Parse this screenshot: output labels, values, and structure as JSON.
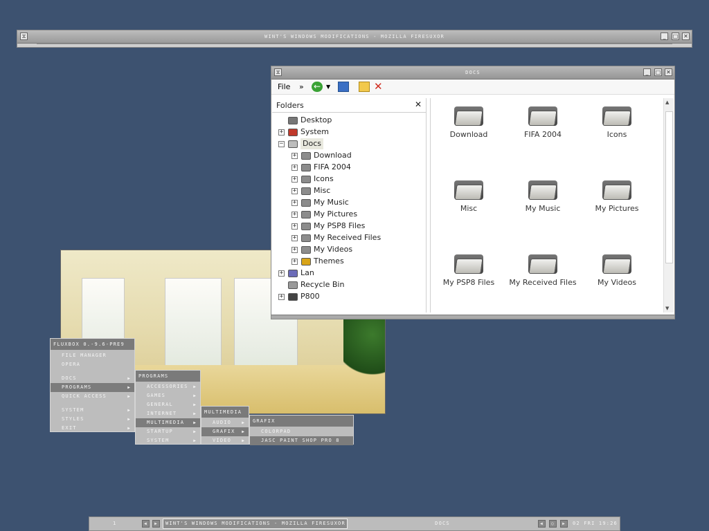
{
  "background_color": "#3d5270",
  "browser_window": {
    "title": "Wint's Windows Modifications - Mozilla Firesuxor"
  },
  "docs_window": {
    "title": "Docs",
    "menu_file": "File",
    "chevron": "»",
    "folders_header": "Folders",
    "close_glyph": "✕",
    "tree": [
      {
        "label": "Desktop",
        "level": 0,
        "expander": "",
        "icon": "desktop-icon"
      },
      {
        "label": "System",
        "level": 0,
        "expander": "+",
        "icon": "system-icon"
      },
      {
        "label": "Docs",
        "level": 0,
        "expander": "−",
        "icon": "docs-icon",
        "selected": true
      },
      {
        "label": "Download",
        "level": 1,
        "expander": "+",
        "icon": "folder-icon"
      },
      {
        "label": "FIFA 2004",
        "level": 1,
        "expander": "+",
        "icon": "folder-icon"
      },
      {
        "label": "Icons",
        "level": 1,
        "expander": "+",
        "icon": "folder-icon"
      },
      {
        "label": "Misc",
        "level": 1,
        "expander": "+",
        "icon": "folder-icon"
      },
      {
        "label": "My Music",
        "level": 1,
        "expander": "+",
        "icon": "folder-icon"
      },
      {
        "label": "My Pictures",
        "level": 1,
        "expander": "+",
        "icon": "folder-icon"
      },
      {
        "label": "My PSP8 Files",
        "level": 1,
        "expander": "+",
        "icon": "folder-icon"
      },
      {
        "label": "My Received Files",
        "level": 1,
        "expander": "+",
        "icon": "folder-icon"
      },
      {
        "label": "My Videos",
        "level": 1,
        "expander": "+",
        "icon": "folder-icon"
      },
      {
        "label": "Themes",
        "level": 1,
        "expander": "+",
        "icon": "themes-icon"
      },
      {
        "label": "Lan",
        "level": 0,
        "expander": "+",
        "icon": "network-icon"
      },
      {
        "label": "Recycle Bin",
        "level": 0,
        "expander": "",
        "icon": "recycle-bin-icon"
      },
      {
        "label": "P800",
        "level": 0,
        "expander": "+",
        "icon": "phone-icon"
      }
    ],
    "files": [
      {
        "label": "Download"
      },
      {
        "label": "FIFA 2004"
      },
      {
        "label": "Icons"
      },
      {
        "label": "Misc"
      },
      {
        "label": "My Music"
      },
      {
        "label": "My Pictures"
      },
      {
        "label": "My PSP8 Files"
      },
      {
        "label": "My Received Files"
      },
      {
        "label": "My Videos"
      }
    ]
  },
  "root_menu": {
    "title": "fluxbox 0.-9.6-pre9",
    "items": [
      "file manager",
      "opera",
      "docs",
      "programs",
      "quick access",
      "system",
      "styles",
      "exit"
    ]
  },
  "programs_menu": {
    "title": "programs",
    "items": [
      "accessories",
      "games",
      "general",
      "internet",
      "multimedia",
      "startup",
      "system"
    ]
  },
  "multimedia_menu": {
    "title": "multimedia",
    "items": [
      "audio",
      "grafix",
      "video"
    ]
  },
  "grafix_menu": {
    "title": "grafix",
    "items": [
      "colorpad",
      "jasc paint shop pro 8"
    ]
  },
  "taskbar": {
    "workspace": "1",
    "task_active": "Wint's Windows Modifications - Mozilla Firesuxor",
    "task_other": "Docs",
    "clock": "02 Fri 19:26"
  }
}
